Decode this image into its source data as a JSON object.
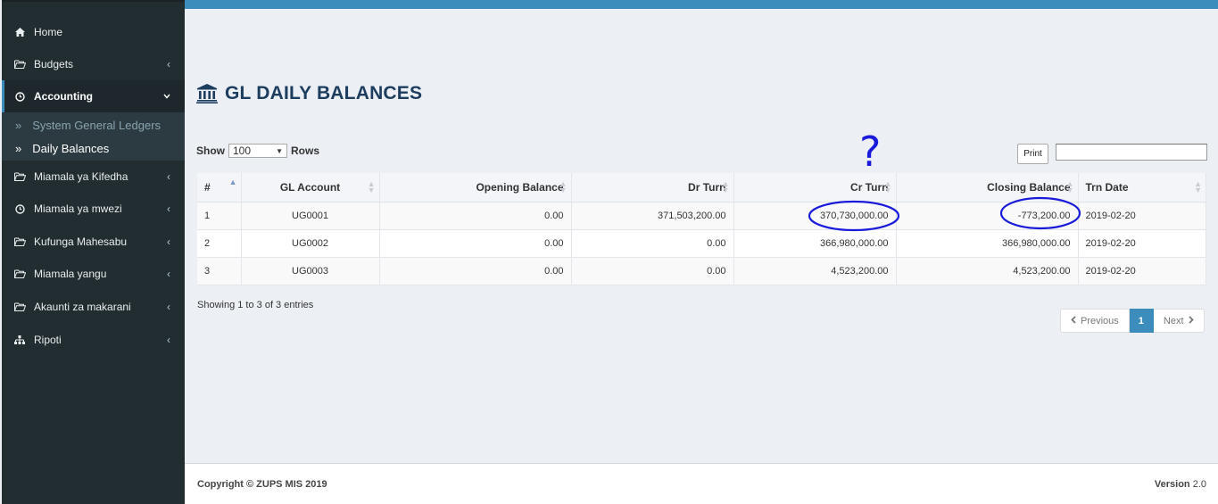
{
  "sidebar": {
    "items": [
      {
        "label": "Home",
        "icon": "home-icon"
      },
      {
        "label": "Budgets",
        "icon": "folder-open-icon"
      },
      {
        "label": "Accounting",
        "icon": "clock-icon"
      },
      {
        "label": "Miamala ya Kifedha",
        "icon": "folder-open-icon"
      },
      {
        "label": "Miamala ya mwezi",
        "icon": "clock-icon"
      },
      {
        "label": "Kufunga Mahesabu",
        "icon": "folder-open-icon"
      },
      {
        "label": "Miamala yangu",
        "icon": "folder-open-icon"
      },
      {
        "label": "Akaunti za makarani",
        "icon": "folder-open-icon"
      },
      {
        "label": "Ripoti",
        "icon": "sitemap-icon"
      }
    ],
    "submenu": [
      {
        "label": "System General Ledgers"
      },
      {
        "label": "Daily Balances"
      }
    ]
  },
  "page": {
    "title": "GL DAILY BALANCES",
    "title_icon": "bank-icon"
  },
  "controls": {
    "show_label": "Show",
    "rows_value": "100",
    "rows_label": "Rows",
    "print_label": "Print",
    "filter_value": ""
  },
  "table": {
    "headers": [
      "#",
      "GL Account",
      "Opening Balance",
      "Dr Turn",
      "Cr Turn",
      "Closing Balance",
      "Trn Date"
    ],
    "rows": [
      [
        "1",
        "UG0001",
        "0.00",
        "371,503,200.00",
        "370,730,000.00",
        "-773,200.00",
        "2019-02-20"
      ],
      [
        "2",
        "UG0002",
        "0.00",
        "0.00",
        "366,980,000.00",
        "366,980,000.00",
        "2019-02-20"
      ],
      [
        "3",
        "UG0003",
        "0.00",
        "0.00",
        "4,523,200.00",
        "4,523,200.00",
        "2019-02-20"
      ]
    ]
  },
  "info": "Showing 1 to 3 of 3 entries",
  "pagination": {
    "previous": "Previous",
    "current": "1",
    "next": "Next"
  },
  "footer": {
    "copyright": "Copyright © ZUPS MIS 2019",
    "version_label": "Version",
    "version_value": "2.0"
  },
  "annotation": {
    "mark": "?",
    "color": "#1a1adb"
  },
  "colors": {
    "accent": "#3c8dbc",
    "sidebar": "#222d32",
    "title": "#1d3d5e"
  }
}
